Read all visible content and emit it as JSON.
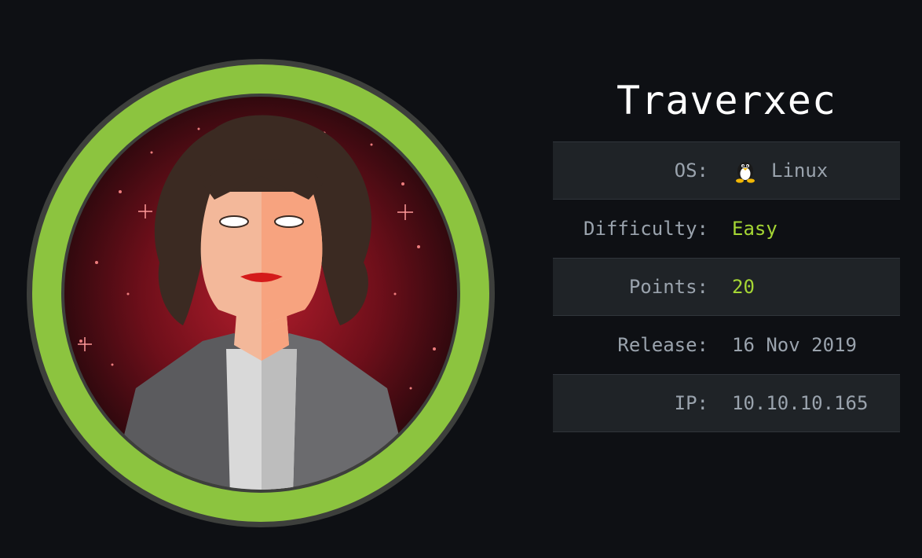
{
  "machine": {
    "name": "Traverxec",
    "info": [
      {
        "label": "OS:",
        "value": "Linux",
        "icon": "tux-icon",
        "highlight": false
      },
      {
        "label": "Difficulty:",
        "value": "Easy",
        "highlight": true
      },
      {
        "label": "Points:",
        "value": "20",
        "highlight": true
      },
      {
        "label": "Release:",
        "value": "16 Nov 2019",
        "highlight": false
      },
      {
        "label": "IP:",
        "value": "10.10.10.165",
        "highlight": false
      }
    ]
  },
  "colors": {
    "background": "#0e1014",
    "ring": "#8cc43f",
    "highlight": "#a5d634",
    "row_shaded": "#1f2327"
  }
}
